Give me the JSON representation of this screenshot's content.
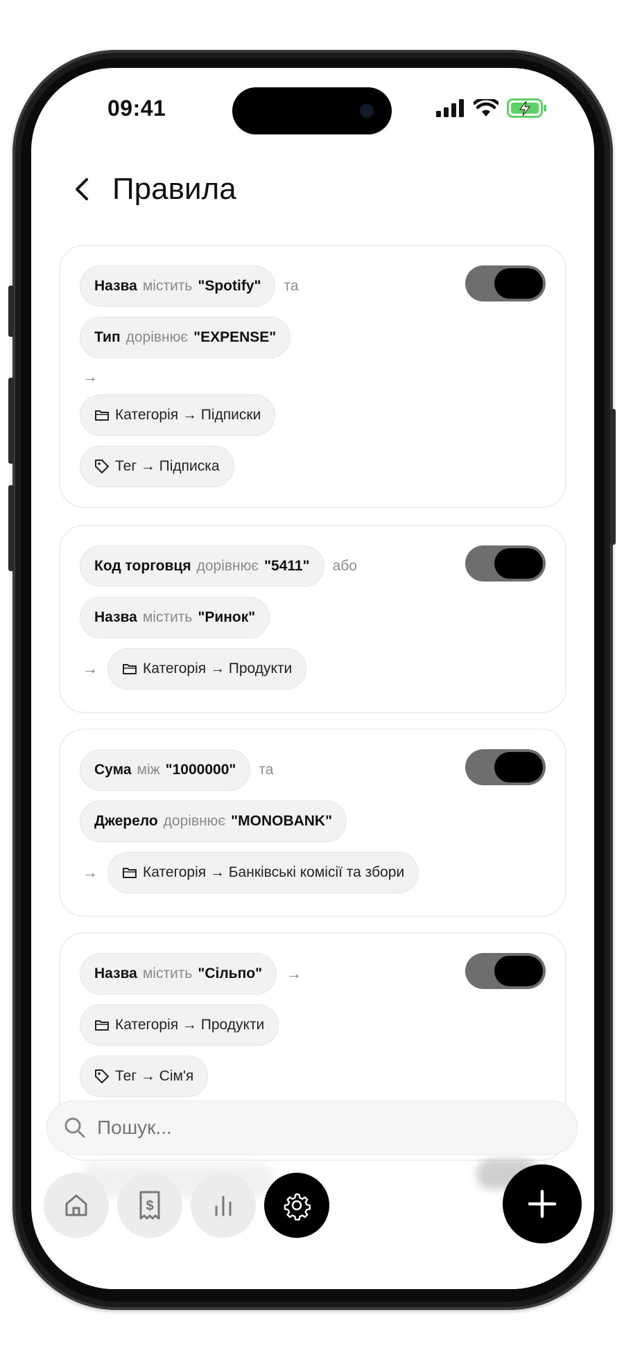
{
  "status_bar": {
    "time": "09:41"
  },
  "header": {
    "title": "Правила"
  },
  "rules": [
    {
      "enabled": true,
      "conditions": [
        {
          "field": "Назва",
          "op": "містить",
          "value": "\"Spotify\"",
          "conj": "та"
        },
        {
          "field": "Тип",
          "op": "дорівнює",
          "value": "\"EXPENSE\"",
          "conj": ""
        }
      ],
      "actions": [
        {
          "icon": "folder-icon",
          "text": "Категорія → Підписки"
        },
        {
          "icon": "tag-icon",
          "text": "Тег → Підписка"
        }
      ]
    },
    {
      "enabled": true,
      "conditions": [
        {
          "field": "Код торговця",
          "op": "дорівнює",
          "value": "\"5411\"",
          "conj": "або"
        },
        {
          "field": "Назва",
          "op": "містить",
          "value": "\"Ринок\"",
          "conj": ""
        }
      ],
      "actions": [
        {
          "icon": "folder-icon",
          "text": "Категорія → Продукти"
        }
      ]
    },
    {
      "enabled": true,
      "conditions": [
        {
          "field": "Сума",
          "op": "між",
          "value": "\"1000000\"",
          "conj": "та"
        },
        {
          "field": "Джерело",
          "op": "дорівнює",
          "value": "\"MONOBANK\"",
          "conj": ""
        }
      ],
      "actions": [
        {
          "icon": "folder-icon",
          "text": "Категорія → Банківські комісії та збори"
        }
      ]
    },
    {
      "enabled": true,
      "conditions": [
        {
          "field": "Назва",
          "op": "містить",
          "value": "\"Сільпо\"",
          "conj": ""
        }
      ],
      "actions": [
        {
          "icon": "folder-icon",
          "text": "Категорія → Продукти"
        },
        {
          "icon": "tag-icon",
          "text": "Тег → Сім'я"
        }
      ]
    }
  ],
  "search": {
    "placeholder": "Пошук..."
  },
  "nav": [
    {
      "icon": "home-icon",
      "active": false
    },
    {
      "icon": "receipt-icon",
      "active": false
    },
    {
      "icon": "chart-icon",
      "active": false
    },
    {
      "icon": "gear-icon",
      "active": true
    }
  ],
  "fab": {
    "icon": "plus-icon"
  }
}
